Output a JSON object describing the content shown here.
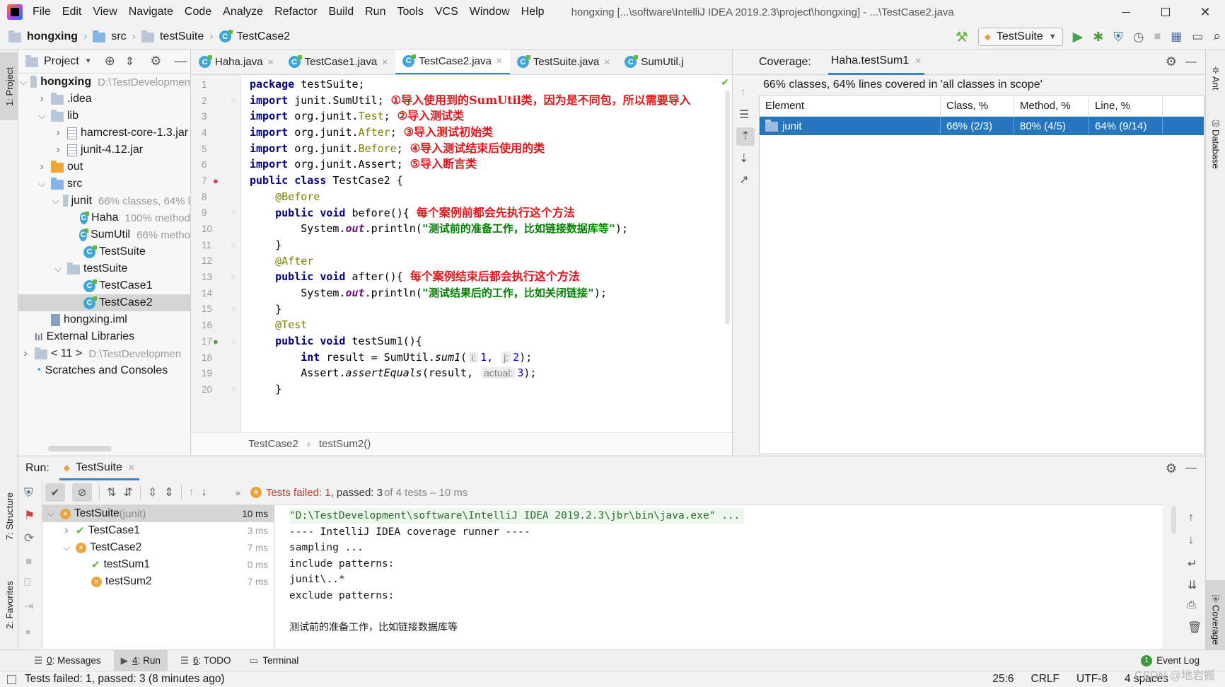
{
  "menu": {
    "items": [
      "File",
      "Edit",
      "View",
      "Navigate",
      "Code",
      "Analyze",
      "Refactor",
      "Build",
      "Run",
      "Tools",
      "VCS",
      "Window",
      "Help"
    ],
    "title": "hongxing [...\\software\\IntelliJ IDEA 2019.2.3\\project\\hongxing] - ...\\TestCase2.java"
  },
  "breadcrumb": [
    "hongxing",
    "src",
    "testSuite",
    "TestCase2"
  ],
  "run_config": "TestSuite",
  "project_panel": {
    "title": "Project",
    "tree": [
      {
        "depth": 0,
        "caret": "v",
        "icon": "folder",
        "label": "hongxing",
        "extra": "D:\\TestDevelopmen",
        "bold": true
      },
      {
        "depth": 1,
        "caret": ">",
        "icon": "folder",
        "label": ".idea",
        "extra": ""
      },
      {
        "depth": 1,
        "caret": "v",
        "icon": "folder",
        "label": "lib",
        "extra": ""
      },
      {
        "depth": 2,
        "caret": ">",
        "icon": "jar",
        "label": "hamcrest-core-1.3.jar",
        "extra": ""
      },
      {
        "depth": 2,
        "caret": ">",
        "icon": "jar",
        "label": "junit-4.12.jar",
        "extra": ""
      },
      {
        "depth": 1,
        "caret": ">",
        "icon": "folder-orange",
        "label": "out",
        "extra": ""
      },
      {
        "depth": 1,
        "caret": "v",
        "icon": "folder-blue",
        "label": "src",
        "extra": ""
      },
      {
        "depth": 2,
        "caret": "v",
        "icon": "folder",
        "label": "junit",
        "extra": "66% classes, 64% l"
      },
      {
        "depth": 3,
        "caret": "",
        "icon": "class",
        "label": "Haha",
        "extra": "100% method"
      },
      {
        "depth": 3,
        "caret": "",
        "icon": "class",
        "label": "SumUtil",
        "extra": "66% metho"
      },
      {
        "depth": 3,
        "caret": "",
        "icon": "class",
        "label": "TestSuite",
        "extra": ""
      },
      {
        "depth": 2,
        "caret": "v",
        "icon": "folder",
        "label": "testSuite",
        "extra": ""
      },
      {
        "depth": 3,
        "caret": "",
        "icon": "class",
        "label": "TestCase1",
        "extra": ""
      },
      {
        "depth": 3,
        "caret": "",
        "icon": "class",
        "label": "TestCase2",
        "extra": "",
        "selected": true
      },
      {
        "depth": 1,
        "caret": "",
        "icon": "iml",
        "label": "hongxing.iml",
        "extra": ""
      },
      {
        "depth": 0,
        "caret": "",
        "icon": "lib",
        "label": "External Libraries",
        "extra": ""
      },
      {
        "depth": 0,
        "caret": ">",
        "icon": "sdk",
        "label": "< 11 >",
        "extra": "D:\\TestDevelopmen"
      },
      {
        "depth": 0,
        "caret": "",
        "icon": "scratch",
        "label": "Scratches and Consoles",
        "extra": ""
      }
    ]
  },
  "editor": {
    "tabs": [
      {
        "label": "Haha.java",
        "active": false,
        "close": true
      },
      {
        "label": "TestCase1.java",
        "active": false,
        "close": true
      },
      {
        "label": "TestCase2.java",
        "active": true,
        "close": true
      },
      {
        "label": "TestSuite.java",
        "active": false,
        "close": true
      },
      {
        "label": "SumUtil.j",
        "active": false,
        "close": false
      }
    ],
    "lines": [
      "1",
      "2",
      "3",
      "4",
      "5",
      "6",
      "7",
      "8",
      "9",
      "10",
      "11",
      "12",
      "13",
      "14",
      "15",
      "16",
      "17",
      "18",
      "19",
      "20"
    ],
    "code": {
      "l1_kw": "package",
      "l1_rest": " testSuite;",
      "import": "import",
      "l2_rest": " junit.SumUtil;",
      "l2_note": "①导入使用到的SumUtil类，因为是不同包，所以需要导入",
      "l3_pkg": " org.junit.",
      "l3_cls": "Test",
      "l3_note": "②导入测试类",
      "l4_pkg": " org.junit.",
      "l4_cls": "After",
      "l4_note": "③导入测试初始类",
      "l5_pkg": " org.junit.",
      "l5_cls": "Before",
      "l5_note": "④导入测试结束后使用的类",
      "l6_rest": " org.junit.Assert;",
      "l6_note": "⑤导入断言类",
      "l7_kw": "public class",
      "l7_rest": " TestCase2 {",
      "l8_ann": "@Before",
      "l9_kw": "public void",
      "l9_rest": " before(){",
      "l9_note": "每个案例前都会先执行这个方法",
      "l10_a": "System.",
      "l10_out": "out",
      "l10_b": ".println(",
      "l10_str": "\"测试前的准备工作，比如链接数据库等\"",
      "l10_c": ");",
      "brace_close": "}",
      "l12_ann": "@After",
      "l13_kw": "public void",
      "l13_rest": " after(){",
      "l13_note": "每个案例结束后都会执行这个方法",
      "l14_str": "\"测试结果后的工作，比如关闭链接\"",
      "l16_ann": "@Test",
      "l17_kw": "public void",
      "l17_rest": " testSum1(){",
      "l18_kw": "int",
      "l18_a": " result = SumUtil.",
      "l18_m": "sum1",
      "l18_b": "(",
      "l18_h1": "i:",
      "l18_n1": "1",
      ", ": ", ",
      "l18_h2": "j:",
      "l18_n2": "2",
      "l18_c": ");",
      "l19_a": "Assert.",
      "l19_m": "assertEquals",
      "l19_b": "(result, ",
      "l19_h": "actual:",
      "l19_n": "3",
      "l19_c": ");"
    },
    "bottom_crumb": [
      "TestCase2",
      "testSum2()"
    ]
  },
  "coverage": {
    "label": "Coverage:",
    "tab": "Haha.testSum1",
    "summary": "66% classes, 64% lines covered in 'all classes in scope'",
    "columns": [
      "Element",
      "Class, %",
      "Method, %",
      "Line, %"
    ],
    "rows": [
      {
        "element": "junit",
        "class": "66% (2/3)",
        "method": "80% (4/5)",
        "line": "64% (9/14)"
      }
    ]
  },
  "run_panel": {
    "label": "Run:",
    "tab": "TestSuite",
    "status_failed": "Tests failed: 1",
    "status_rest": ", passed: 3",
    "status_of": " of 4 tests – 10 ms",
    "tree": [
      {
        "depth": 0,
        "status": "fail",
        "label": "TestSuite",
        "suffix": " (junit)",
        "time": "10 ms",
        "selected": true,
        "caret": "v"
      },
      {
        "depth": 1,
        "status": "pass",
        "label": "TestCase1",
        "suffix": "",
        "time": "3 ms",
        "caret": ">"
      },
      {
        "depth": 1,
        "status": "fail",
        "label": "TestCase2",
        "suffix": "",
        "time": "7 ms",
        "caret": "v"
      },
      {
        "depth": 2,
        "status": "pass",
        "label": "testSum1",
        "suffix": "",
        "time": "0 ms",
        "caret": ""
      },
      {
        "depth": 2,
        "status": "fail",
        "label": "testSum2",
        "suffix": "",
        "time": "7 ms",
        "caret": ""
      }
    ],
    "console": [
      "\"D:\\TestDevelopment\\software\\IntelliJ IDEA 2019.2.3\\jbr\\bin\\java.exe\" ...",
      "---- IntelliJ IDEA coverage runner ----",
      "sampling ...",
      "include patterns:",
      "junit\\..*",
      "exclude patterns:",
      "",
      "测试前的准备工作，比如链接数据库等"
    ]
  },
  "bottom_tools": [
    {
      "key": "0",
      "label": ": Messages"
    },
    {
      "key": "4",
      "label": ": Run"
    },
    {
      "key": "6",
      "label": ": TODO"
    },
    {
      "key": "",
      "label": "Terminal"
    }
  ],
  "event_log": "Event Log",
  "event_count": "1",
  "left_side_tabs": [
    "1: Project",
    "7: Structure",
    "2: Favorites"
  ],
  "right_side_tabs": [
    "Ant",
    "Database",
    "Coverage"
  ],
  "status_bar": {
    "message": "Tests failed: 1, passed: 3 (8 minutes ago)",
    "position": "25:6",
    "line_sep": "CRLF",
    "encoding": "UTF-8",
    "indent": "4 spaces",
    "watermark": "CSDN @地岩搬"
  },
  "colors": {
    "selection": "#2675bf",
    "fail": "#e8a33d",
    "pass": "#5fb83b",
    "red_note": "#e0161a"
  }
}
